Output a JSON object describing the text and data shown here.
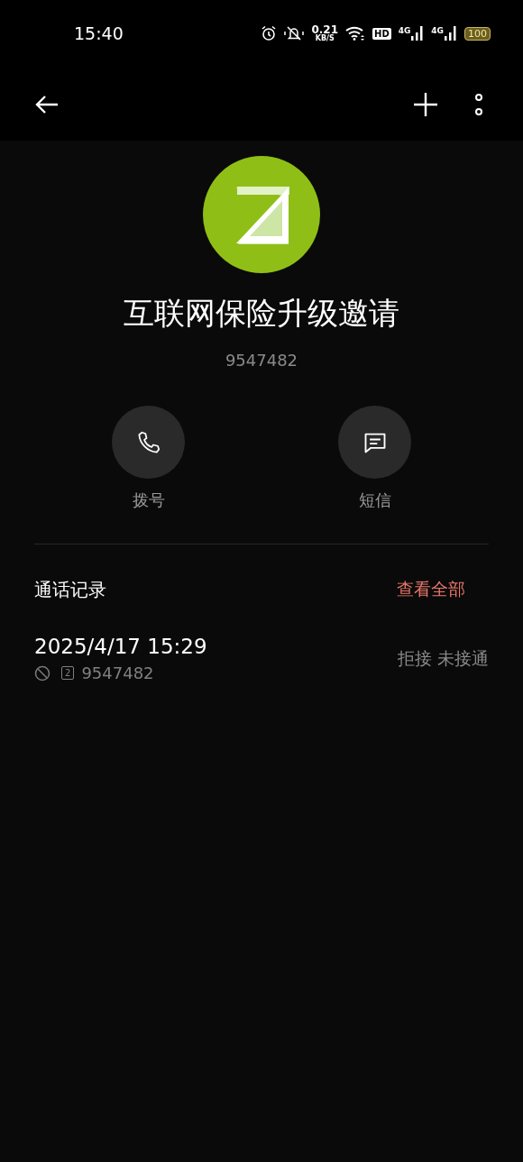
{
  "status_bar": {
    "time": "15:40",
    "speed_value": "0.21",
    "speed_unit": "KB/S",
    "hd": "HD",
    "sim1": "4G",
    "sim2": "4G",
    "battery": "100"
  },
  "contact": {
    "name": "互联网保险升级邀请",
    "number": "9547482"
  },
  "actions": [
    {
      "kind": "call",
      "label": "拨号"
    },
    {
      "kind": "message",
      "label": "短信"
    }
  ],
  "call_log": {
    "title": "通话记录",
    "view_all": "查看全部",
    "entries": [
      {
        "time": "2025/4/17 15:29",
        "sim": "2",
        "number": "9547482",
        "status": "拒接 未接通",
        "blocked": true
      }
    ]
  }
}
